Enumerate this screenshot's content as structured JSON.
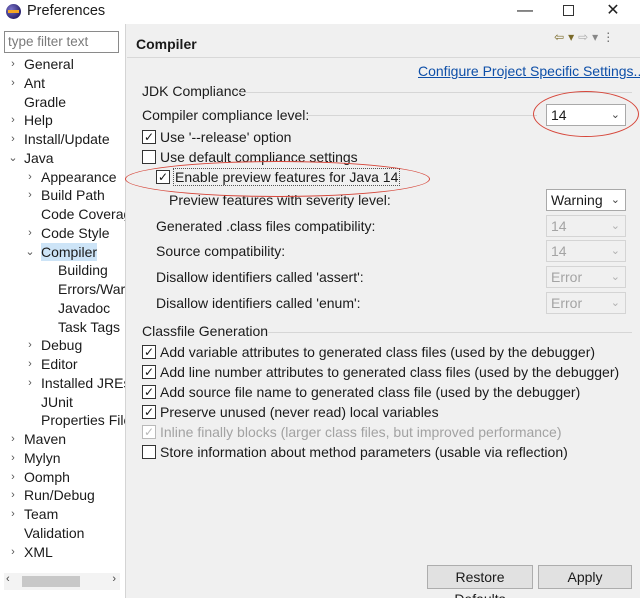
{
  "window": {
    "title": "Preferences",
    "min_glyph": "—",
    "close_glyph": "✕"
  },
  "sidebar": {
    "filter_placeholder": "type filter text",
    "items": [
      {
        "label": "General",
        "arrow": "›"
      },
      {
        "label": "Ant",
        "arrow": "›"
      },
      {
        "label": "Gradle",
        "arrow": ""
      },
      {
        "label": "Help",
        "arrow": "›"
      },
      {
        "label": "Install/Update",
        "arrow": "›"
      },
      {
        "label": "Java",
        "arrow": "⌄"
      },
      {
        "label": "Appearance",
        "arrow": "›"
      },
      {
        "label": "Build Path",
        "arrow": "›"
      },
      {
        "label": "Code Coverage",
        "arrow": ""
      },
      {
        "label": "Code Style",
        "arrow": "›"
      },
      {
        "label": "Compiler",
        "arrow": "⌄"
      },
      {
        "label": "Building",
        "arrow": ""
      },
      {
        "label": "Errors/Warnings",
        "arrow": ""
      },
      {
        "label": "Javadoc",
        "arrow": ""
      },
      {
        "label": "Task Tags",
        "arrow": ""
      },
      {
        "label": "Debug",
        "arrow": "›"
      },
      {
        "label": "Editor",
        "arrow": "›"
      },
      {
        "label": "Installed JREs",
        "arrow": "›"
      },
      {
        "label": "JUnit",
        "arrow": ""
      },
      {
        "label": "Properties Files Editor",
        "arrow": ""
      },
      {
        "label": "Maven",
        "arrow": "›"
      },
      {
        "label": "Mylyn",
        "arrow": "›"
      },
      {
        "label": "Oomph",
        "arrow": "›"
      },
      {
        "label": "Run/Debug",
        "arrow": "›"
      },
      {
        "label": "Team",
        "arrow": "›"
      },
      {
        "label": "Validation",
        "arrow": ""
      },
      {
        "label": "XML",
        "arrow": "›"
      }
    ],
    "scroll_left": "‹",
    "scroll_right": "›"
  },
  "page": {
    "title": "Compiler",
    "config_link": "Configure Project Specific Settings...",
    "jdk_group": "JDK Compliance",
    "compliance_label": "Compiler compliance level:",
    "compliance_value": "14",
    "use_release": "Use '--release' option",
    "use_default": "Use default compliance settings",
    "enable_preview": "Enable preview features for Java 14",
    "preview_severity_label": "Preview features with severity level:",
    "preview_severity_value": "Warning",
    "generated_label": "Generated .class files compatibility:",
    "generated_value": "14",
    "source_label": "Source compatibility:",
    "source_value": "14",
    "assert_label": "Disallow identifiers called 'assert':",
    "assert_value": "Error",
    "enum_label": "Disallow identifiers called 'enum':",
    "enum_value": "Error",
    "classfile_group": "Classfile Generation",
    "cf_variable": "Add variable attributes to generated class files (used by the debugger)",
    "cf_line": "Add line number attributes to generated class files (used by the debugger)",
    "cf_source": "Add source file name to generated class file (used by the debugger)",
    "cf_preserve": "Preserve unused (never read) local variables",
    "cf_inline": "Inline finally blocks (larger class files, but improved performance)",
    "cf_store": "Store information about method parameters (usable via reflection)",
    "restore_defaults": "Restore Defaults",
    "apply": "Apply"
  },
  "checked_glyph": "✓",
  "highlight_color": "#d6463a"
}
